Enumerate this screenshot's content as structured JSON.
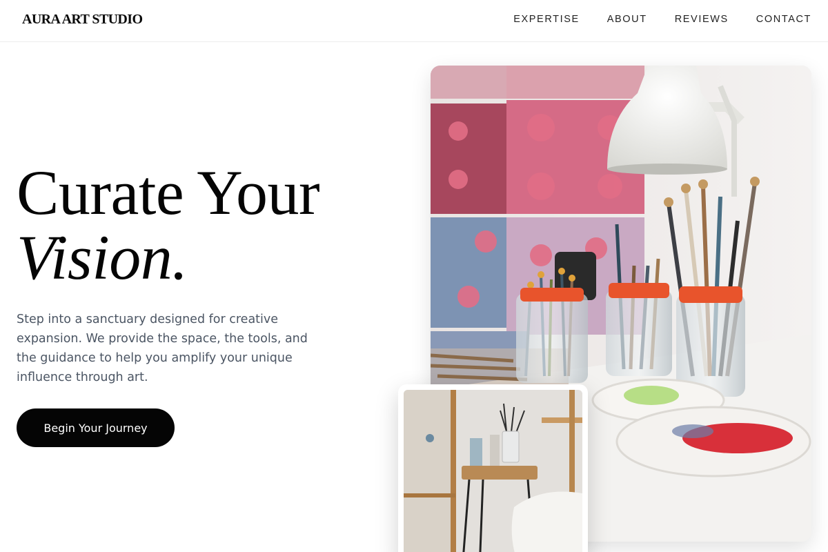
{
  "header": {
    "logo": "AURA ART STUDIO",
    "nav": [
      "EXPERTISE",
      "ABOUT",
      "REVIEWS",
      "CONTACT"
    ]
  },
  "hero": {
    "title_line1": "Curate Your",
    "title_line2": "Vision.",
    "description": "Step into a sanctuary designed for creative expansion. We provide the space, the tools, and the guidance to help you amplify your unique influence through art.",
    "cta_label": "Begin Your Journey"
  },
  "colors": {
    "text_dark": "#050505",
    "text_muted": "#4b5563",
    "button_bg": "#050505",
    "accent_orange": "#e8542c"
  }
}
